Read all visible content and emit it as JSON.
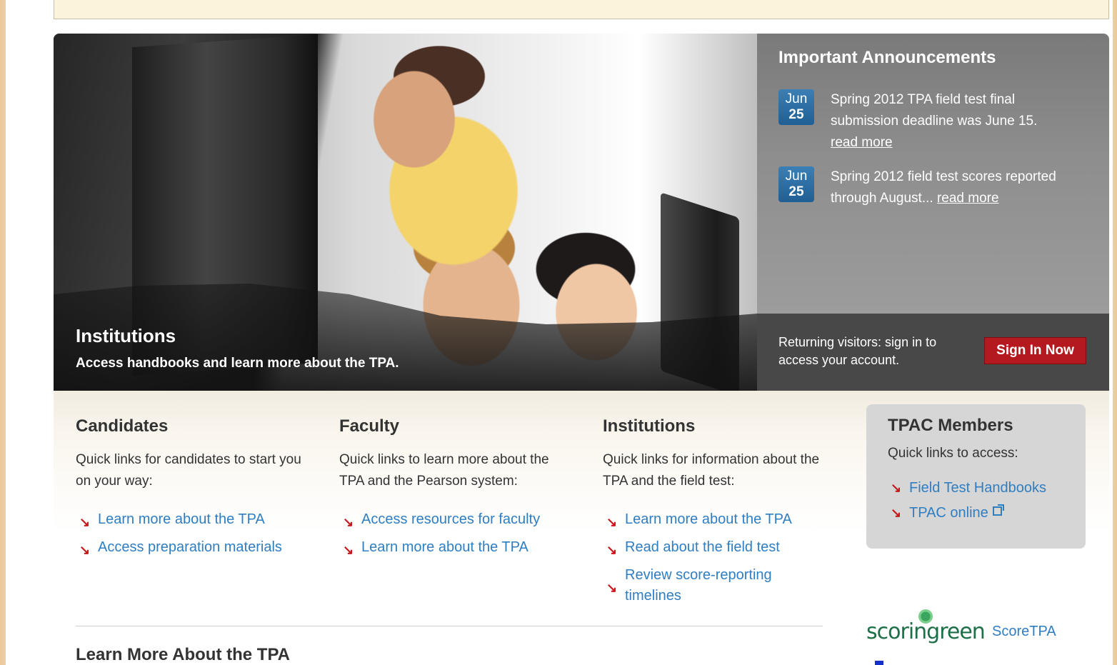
{
  "hero": {
    "title": "Institutions",
    "subtitle": "Access handbooks and learn more about the TPA."
  },
  "announcements": {
    "heading": "Important Announcements",
    "items": [
      {
        "month": "Jun",
        "day": "25",
        "text": "Spring 2012 TPA field test final submission deadline was June 15.",
        "link": "read more"
      },
      {
        "month": "Jun",
        "day": "25",
        "text": "Spring 2012 field test scores reported through August...",
        "link": "read more"
      }
    ]
  },
  "signin": {
    "text": "Returning visitors: sign in to access your account.",
    "button": "Sign In Now"
  },
  "columns": [
    {
      "heading": "Candidates",
      "intro": "Quick links for candidates to start you on your way:",
      "links": [
        "Learn more about the TPA",
        "Access preparation materials"
      ]
    },
    {
      "heading": "Faculty",
      "intro": "Quick links to learn more about the TPA and the Pearson system:",
      "links": [
        "Access resources for faculty",
        "Learn more about the TPA"
      ]
    },
    {
      "heading": "Institutions",
      "intro": "Quick links for information about the TPA and the field test:",
      "links": [
        "Learn more about the TPA",
        "Read about the field test",
        "Review score-reporting timelines"
      ]
    }
  ],
  "tpac": {
    "heading": "TPAC Members",
    "intro": "Quick links to access:",
    "links": [
      "Field Test Handbooks",
      "TPAC online"
    ]
  },
  "learn_more_heading": "Learn More About the TPA",
  "scoring": {
    "logo_text": "scoringreen",
    "link": "ScoreTPA"
  },
  "colors": {
    "link": "#2f7ec2",
    "accent_red": "#b3191e",
    "date_badge": "#2a6fa6"
  }
}
